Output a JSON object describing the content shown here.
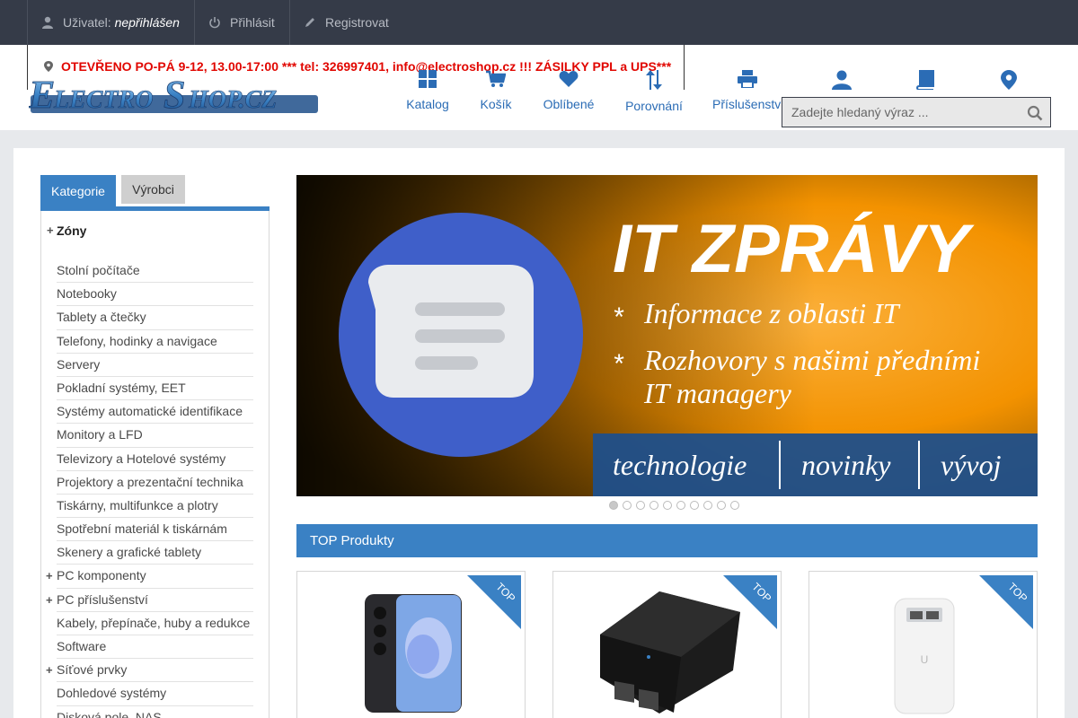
{
  "topbar": {
    "user_label": "Uživatel:",
    "user_status": "nepřihlášen",
    "login": "Přihlásit",
    "register": "Registrovat"
  },
  "header": {
    "notice": "OTEVŘENO PO-PÁ 9-12, 13.00-17:00 *** tel: 326997401, info@electroshop.cz !!! ZÁSILKY PPL a UPS***",
    "logo_text": "ElectroShop.cz",
    "nav": {
      "catalog": "Katalog",
      "cart": "Košík",
      "favorites": "Oblíbené",
      "compare": "Porovnání",
      "accessories": "Příslušenství"
    },
    "search_placeholder": "Zadejte hledaný výraz ..."
  },
  "sidebar": {
    "tabs": [
      "Kategorie",
      "Výrobci"
    ],
    "zone_title": "Zóny",
    "categories": [
      {
        "label": "Stolní počítače",
        "plus": ""
      },
      {
        "label": "Notebooky",
        "plus": ""
      },
      {
        "label": "Tablety a čtečky",
        "plus": ""
      },
      {
        "label": "Telefony, hodinky a navigace",
        "plus": ""
      },
      {
        "label": "Servery",
        "plus": ""
      },
      {
        "label": "Pokladní systémy, EET",
        "plus": ""
      },
      {
        "label": "Systémy automatické identifikace",
        "plus": ""
      },
      {
        "label": "Monitory a LFD",
        "plus": ""
      },
      {
        "label": "Televizory a Hotelové systémy",
        "plus": ""
      },
      {
        "label": "Projektory a prezentační technika",
        "plus": ""
      },
      {
        "label": "Tiskárny, multifunkce a plotry",
        "plus": ""
      },
      {
        "label": "Spotřební materiál k tiskárnám",
        "plus": ""
      },
      {
        "label": "Skenery a grafické tablety",
        "plus": ""
      },
      {
        "label": "PC komponenty",
        "plus": "+"
      },
      {
        "label": "PC příslušenství",
        "plus": "+"
      },
      {
        "label": "Kabely, přepínače, huby a redukce",
        "plus": ""
      },
      {
        "label": "Software",
        "plus": ""
      },
      {
        "label": "Síťové prvky",
        "plus": "+"
      },
      {
        "label": "Dohledové systémy",
        "plus": ""
      },
      {
        "label": "Disková pole, NAS",
        "plus": ""
      }
    ]
  },
  "banner": {
    "headline": "IT ZPRÁVY",
    "bullet1": "Informace z oblasti IT",
    "bullet2a": "Rozhovory s našimi předními",
    "bullet2b": "IT managery",
    "footer": [
      "technologie",
      "novinky",
      "vývoj"
    ],
    "slide_count": 10,
    "active_slide": 1
  },
  "top_products": {
    "title": "TOP Produkty",
    "badge": "TOP",
    "items": [
      {
        "icon": "smartphone-image"
      },
      {
        "icon": "poe-injector-image"
      },
      {
        "icon": "poe-adapter-image"
      }
    ]
  },
  "colors": {
    "topbar_bg": "#353b48",
    "accent": "#3a81c4",
    "notice": "#e10600",
    "banner_orange": "#f39200"
  }
}
